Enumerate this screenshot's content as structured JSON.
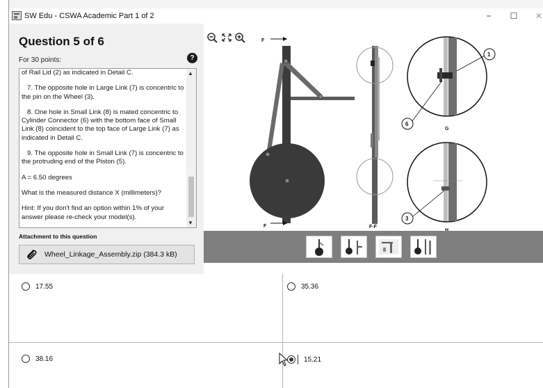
{
  "window": {
    "title": "SW Edu - CSWA Academic Part 1 of 2",
    "minimize": "−",
    "maximize": "☐",
    "close": "✕"
  },
  "question": {
    "title": "Question 5 of 6",
    "points": "For 30 points:",
    "help": "?",
    "body": [
      "of Rail Lid (2) as indicated in Detail C.",
      "   7. The opposite hole in Large Link (7) is concentric to the pin on the Wheel (3).",
      "   8. One hole in Small Link (8) is mated concentric to Cylinder Connector (6) with the bottom face of Small Link (8) coincident to the top face of Large Link (7) as indicated in Detail C.",
      "   9. The opposite hole in Small Link (7) is concentric to the protruding end of the Piston (5).",
      "A = 6.50 degrees",
      "What is the measured distance X (millimeters)?",
      "Hint: If you don't find an option within 1% of your answer please re-check your model(s)."
    ]
  },
  "attachment": {
    "label": "Attachment to this question",
    "file": "Wheel_Linkage_Assembly.zip (384.3 kB)"
  },
  "drawing": {
    "section_top": "F",
    "section_bottom": "F",
    "section_view": "F-F",
    "detail_g": "G",
    "detail_h": "H",
    "balloons": [
      "1",
      "6",
      "3"
    ]
  },
  "answers": [
    {
      "label": "17.55",
      "selected": false
    },
    {
      "label": "35.36",
      "selected": false
    },
    {
      "label": "38.16",
      "selected": false
    },
    {
      "label": "15.21",
      "selected": true
    }
  ]
}
